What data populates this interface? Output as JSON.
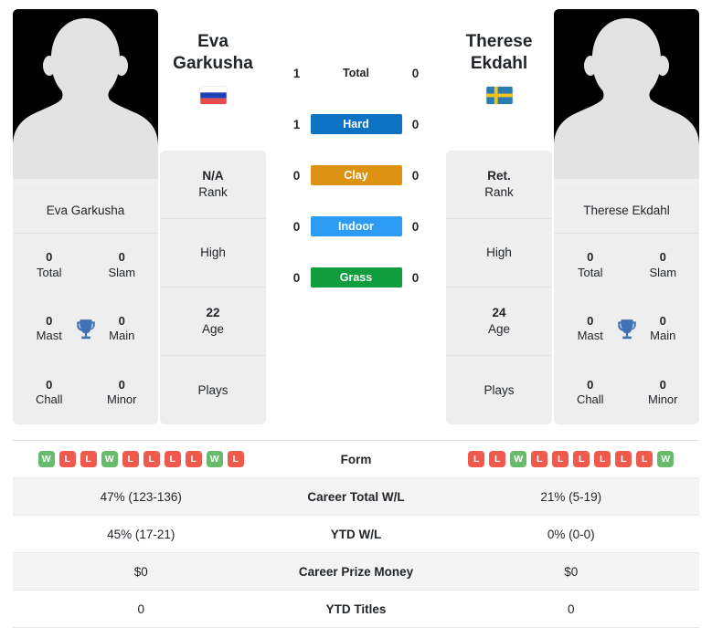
{
  "players": {
    "left": {
      "first_name": "Eva",
      "last_name": "Garkusha",
      "full_name": "Eva Garkusha",
      "country": "russia",
      "flag_icon": "flag-russia-icon",
      "rank": "N/A",
      "rank_label": "Rank",
      "high_label": "High",
      "high_value": "",
      "age": "22",
      "age_label": "Age",
      "plays_label": "Plays",
      "plays_value": "",
      "titles": [
        {
          "num": "0",
          "label": "Total"
        },
        {
          "num": "0",
          "label": "Slam"
        },
        {
          "num": "0",
          "label": "Mast"
        },
        {
          "num": "0",
          "label": "Main"
        },
        {
          "num": "0",
          "label": "Chall"
        },
        {
          "num": "0",
          "label": "Minor"
        }
      ]
    },
    "right": {
      "first_name": "Therese",
      "last_name": "Ekdahl",
      "full_name": "Therese Ekdahl",
      "country": "sweden",
      "flag_icon": "flag-sweden-icon",
      "rank": "Ret.",
      "rank_label": "Rank",
      "high_label": "High",
      "high_value": "",
      "age": "24",
      "age_label": "Age",
      "plays_label": "Plays",
      "plays_value": "",
      "titles": [
        {
          "num": "0",
          "label": "Total"
        },
        {
          "num": "0",
          "label": "Slam"
        },
        {
          "num": "0",
          "label": "Mast"
        },
        {
          "num": "0",
          "label": "Main"
        },
        {
          "num": "0",
          "label": "Chall"
        },
        {
          "num": "0",
          "label": "Minor"
        }
      ]
    }
  },
  "h2h": [
    {
      "label": "Total",
      "left": "1",
      "right": "0",
      "color": "transparent",
      "style": "plain"
    },
    {
      "label": "Hard",
      "left": "1",
      "right": "0",
      "color": "#0b72c4",
      "style": "badge"
    },
    {
      "label": "Clay",
      "left": "0",
      "right": "0",
      "color": "#dd9212",
      "style": "badge"
    },
    {
      "label": "Indoor",
      "left": "0",
      "right": "0",
      "color": "#2b9bf4",
      "style": "badge"
    },
    {
      "label": "Grass",
      "left": "0",
      "right": "0",
      "color": "#0f9d3e",
      "style": "badge"
    }
  ],
  "stats_rows": [
    {
      "label": "Form",
      "type": "form",
      "left_form": [
        "W",
        "L",
        "L",
        "W",
        "L",
        "L",
        "L",
        "L",
        "W",
        "L"
      ],
      "right_form": [
        "L",
        "L",
        "W",
        "L",
        "L",
        "L",
        "L",
        "L",
        "L",
        "W"
      ]
    },
    {
      "label": "Career Total W/L",
      "type": "text",
      "left": "47% (123-136)",
      "right": "21% (5-19)"
    },
    {
      "label": "YTD W/L",
      "type": "text",
      "left": "45% (17-21)",
      "right": "0% (0-0)"
    },
    {
      "label": "Career Prize Money",
      "type": "text",
      "left": "$0",
      "right": "$0"
    },
    {
      "label": "YTD Titles",
      "type": "text",
      "left": "0",
      "right": "0"
    }
  ],
  "colors": {
    "win": "#68bb6c",
    "loss": "#ef5a4c",
    "hard": "#0b72c4",
    "clay": "#dd9212",
    "indoor": "#2b9bf4",
    "grass": "#0f9d3e",
    "card_bg": "#eeeeee",
    "row_alt_bg": "#f4f4f4"
  }
}
